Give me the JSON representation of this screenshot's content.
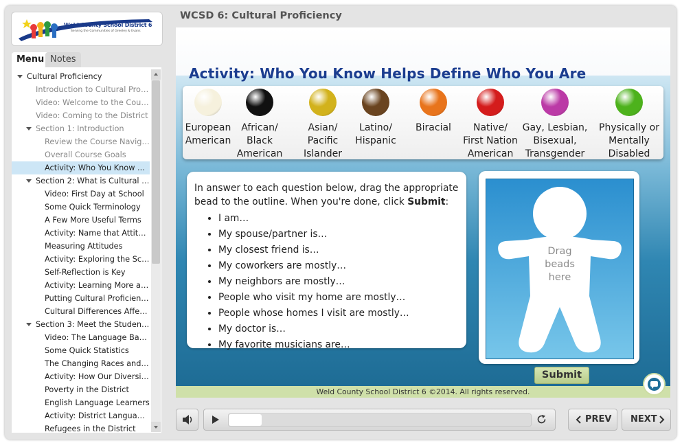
{
  "window": {
    "title": "WCSD 6: Cultural Proficiency"
  },
  "logo": {
    "name": "Weld County School District 6",
    "tagline": "Serving the Communities of Greeley & Evans"
  },
  "sidebar": {
    "tabs": [
      {
        "label": "Menu",
        "active": true
      },
      {
        "label": "Notes",
        "active": false
      }
    ],
    "items": [
      {
        "label": "Cultural Proficiency",
        "level": 0,
        "expanded": true,
        "dim": false,
        "selected": false
      },
      {
        "label": "Introduction to Cultural Prof...",
        "level": 1,
        "dim": true,
        "selected": false
      },
      {
        "label": "Video: Welcome to the Course",
        "level": 1,
        "dim": true,
        "selected": false
      },
      {
        "label": "Video: Coming to the District",
        "level": 1,
        "dim": true,
        "selected": false
      },
      {
        "label": "Section 1: Introduction",
        "level": 1,
        "expanded": true,
        "dim": true,
        "selected": false
      },
      {
        "label": "Review the Course Naviga...",
        "level": 2,
        "dim": true,
        "selected": false
      },
      {
        "label": "Overall Course Goals",
        "level": 2,
        "dim": true,
        "selected": false
      },
      {
        "label": "Activity: Who You Know ...",
        "level": 2,
        "dim": false,
        "selected": true
      },
      {
        "label": "Section 2: What is Cultural Pr...",
        "level": 1,
        "expanded": true,
        "dim": false,
        "selected": false
      },
      {
        "label": "Video: First Day at School",
        "level": 2,
        "dim": false,
        "selected": false
      },
      {
        "label": "Some Quick Terminology",
        "level": 2,
        "dim": false,
        "selected": false
      },
      {
        "label": "A Few More Useful Terms",
        "level": 2,
        "dim": false,
        "selected": false
      },
      {
        "label": "Activity: Name that Attitude",
        "level": 2,
        "dim": false,
        "selected": false
      },
      {
        "label": "Measuring Attitudes",
        "level": 2,
        "dim": false,
        "selected": false
      },
      {
        "label": "Activity: Exploring the Scale",
        "level": 2,
        "dim": false,
        "selected": false
      },
      {
        "label": "Self-Reflection is Key",
        "level": 2,
        "dim": false,
        "selected": false
      },
      {
        "label": "Activity: Learning More ab...",
        "level": 2,
        "dim": false,
        "selected": false
      },
      {
        "label": "Putting Cultural Proficienc...",
        "level": 2,
        "dim": false,
        "selected": false
      },
      {
        "label": "Cultural Differences Affec...",
        "level": 2,
        "dim": false,
        "selected": false
      },
      {
        "label": "Section 3: Meet the Students...",
        "level": 1,
        "expanded": true,
        "dim": false,
        "selected": false
      },
      {
        "label": "Video: The Language Barri...",
        "level": 2,
        "dim": false,
        "selected": false
      },
      {
        "label": "Some Quick Statistics",
        "level": 2,
        "dim": false,
        "selected": false
      },
      {
        "label": "The Changing Races and N...",
        "level": 2,
        "dim": false,
        "selected": false
      },
      {
        "label": "Activity: How Our Diversit...",
        "level": 2,
        "dim": false,
        "selected": false
      },
      {
        "label": "Poverty in the District",
        "level": 2,
        "dim": false,
        "selected": false
      },
      {
        "label": "English Language Learners",
        "level": 2,
        "dim": false,
        "selected": false
      },
      {
        "label": "Activity: District Languages",
        "level": 2,
        "dim": false,
        "selected": false
      },
      {
        "label": "Refugees in the District",
        "level": 2,
        "dim": false,
        "selected": false
      }
    ]
  },
  "slide": {
    "title": "Activity: Who You Know Helps Define Who You Are",
    "beads": [
      {
        "label": "European\nAmerican",
        "color": "#f6f1dd"
      },
      {
        "label": "African/\nBlack\nAmerican",
        "color": "#111111"
      },
      {
        "label": "Asian/\nPacific\nIslander",
        "color": "#d2b21c"
      },
      {
        "label": "Latino/\nHispanic",
        "color": "#6a4420"
      },
      {
        "label": "Biracial",
        "color": "#e8741c"
      },
      {
        "label": "Native/\nFirst Nation\nAmerican",
        "color": "#d41c1c"
      },
      {
        "label": "Gay, Lesbian,\nBisexual,\nTransgender",
        "color": "#bb3aa6"
      },
      {
        "label": "Physically or\nMentally\nDisabled",
        "color": "#4db21c"
      }
    ],
    "instructions_pre": "In answer to each question below, drag the appropriate bead to the outline. When you're done, click ",
    "instructions_bold": "Submit",
    "instructions_post": ":",
    "questions": [
      "I am…",
      "My spouse/partner is…",
      "My closest friend is…",
      "My coworkers are mostly…",
      "My neighbors are mostly…",
      "People who visit my home are mostly…",
      "People whose homes I visit are mostly…",
      "My doctor is…",
      "My favorite musicians are…"
    ],
    "drop_hint": "Drag\nbeads\nhere",
    "submit_label": "Submit",
    "footer": "Weld County School District 6 ©2014. All rights reserved."
  },
  "player": {
    "progress": 0.11,
    "prev_label": "PREV",
    "next_label": "NEXT",
    "icons": [
      "volume-icon",
      "play-icon",
      "replay-icon",
      "chat-icon"
    ]
  }
}
